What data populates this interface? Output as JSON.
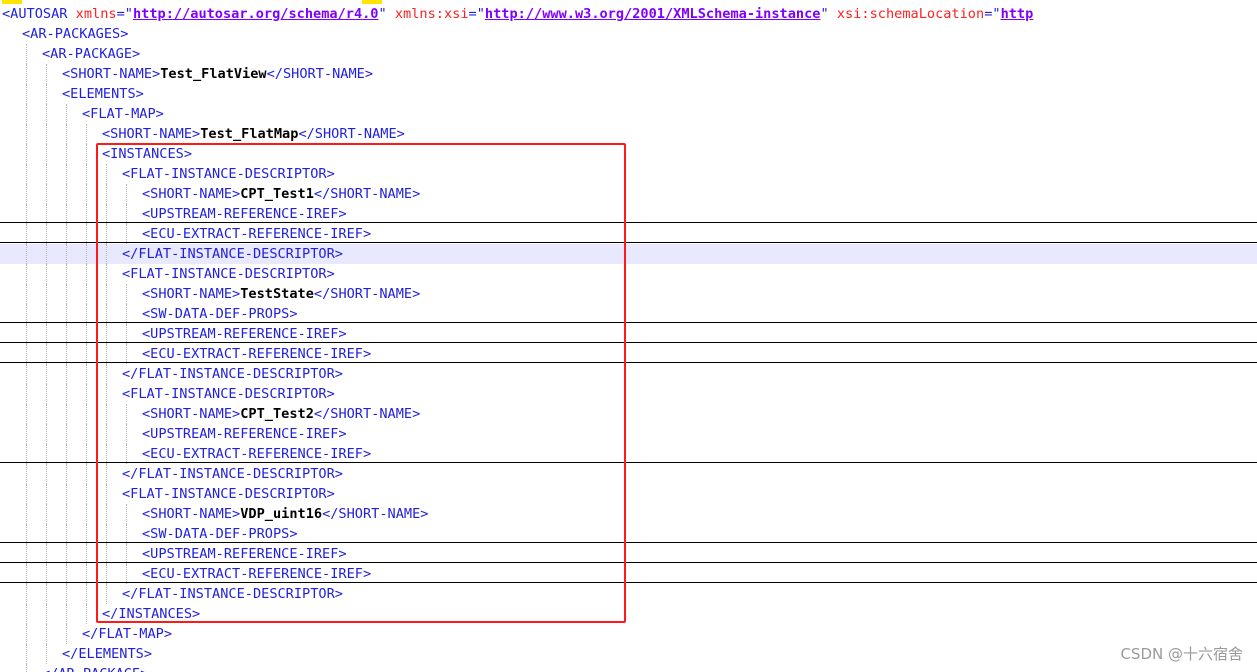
{
  "editor": {
    "lines": [
      {
        "tag": "<AUTOSAR",
        "attrs": [
          {
            "name": "xmlns",
            "value": "http://autosar.org/schema/r4.0",
            "link": true
          },
          {
            "name": "xmlns:xsi",
            "value": "http://www.w3.org/2001/XMLSchema-instance",
            "link": true
          },
          {
            "name": "xsi:schemaLocation",
            "value": "http",
            "link": true
          }
        ]
      },
      {
        "tag": "<AR-PACKAGES>"
      },
      {
        "tag": "<AR-PACKAGE>"
      },
      {
        "tag": "<SHORT-NAME>",
        "name": "Test_FlatView",
        "close": "</SHORT-NAME>"
      },
      {
        "tag": "<ELEMENTS>"
      },
      {
        "tag": "<FLAT-MAP>"
      },
      {
        "tag": "<SHORT-NAME>",
        "name": "Test_FlatMap",
        "close": "</SHORT-NAME>"
      },
      {
        "tag": "<INSTANCES>"
      },
      {
        "tag": "<FLAT-INSTANCE-DESCRIPTOR>"
      },
      {
        "tag": "<SHORT-NAME>",
        "name": "CPT_Test1",
        "close": "</SHORT-NAME>"
      },
      {
        "tag": "<UPSTREAM-REFERENCE-IREF>"
      },
      {
        "tag": "<ECU-EXTRACT-REFERENCE-IREF>"
      },
      {
        "tag": "</FLAT-INSTANCE-DESCRIPTOR>"
      },
      {
        "tag": "<FLAT-INSTANCE-DESCRIPTOR>"
      },
      {
        "tag": "<SHORT-NAME>",
        "name": "TestState",
        "close": "</SHORT-NAME>"
      },
      {
        "tag": "<SW-DATA-DEF-PROPS>"
      },
      {
        "tag": "<UPSTREAM-REFERENCE-IREF>"
      },
      {
        "tag": "<ECU-EXTRACT-REFERENCE-IREF>"
      },
      {
        "tag": "</FLAT-INSTANCE-DESCRIPTOR>"
      },
      {
        "tag": "<FLAT-INSTANCE-DESCRIPTOR>"
      },
      {
        "tag": "<SHORT-NAME>",
        "name": "CPT_Test2",
        "close": "</SHORT-NAME>"
      },
      {
        "tag": "<UPSTREAM-REFERENCE-IREF>"
      },
      {
        "tag": "<ECU-EXTRACT-REFERENCE-IREF>"
      },
      {
        "tag": "</FLAT-INSTANCE-DESCRIPTOR>"
      },
      {
        "tag": "<FLAT-INSTANCE-DESCRIPTOR>"
      },
      {
        "tag": "<SHORT-NAME>",
        "name": "VDP_uint16",
        "close": "</SHORT-NAME>"
      },
      {
        "tag": "<SW-DATA-DEF-PROPS>"
      },
      {
        "tag": "<UPSTREAM-REFERENCE-IREF>"
      },
      {
        "tag": "<ECU-EXTRACT-REFERENCE-IREF>"
      },
      {
        "tag": "</FLAT-INSTANCE-DESCRIPTOR>"
      },
      {
        "tag": "</INSTANCES>"
      },
      {
        "tag": "</FLAT-MAP>"
      },
      {
        "tag": "</ELEMENTS>"
      },
      {
        "tag": "</AR-PACKAGE>"
      }
    ]
  },
  "watermark": "CSDN @十六宿舍",
  "colors": {
    "tag": "#1f1fdd",
    "attribute": "#ff2020",
    "value": "#8000ff",
    "name": "#000000",
    "highlight": "#e8e8ff",
    "selection_box": "#ff1a1a",
    "match_marker": "#ffe400"
  }
}
